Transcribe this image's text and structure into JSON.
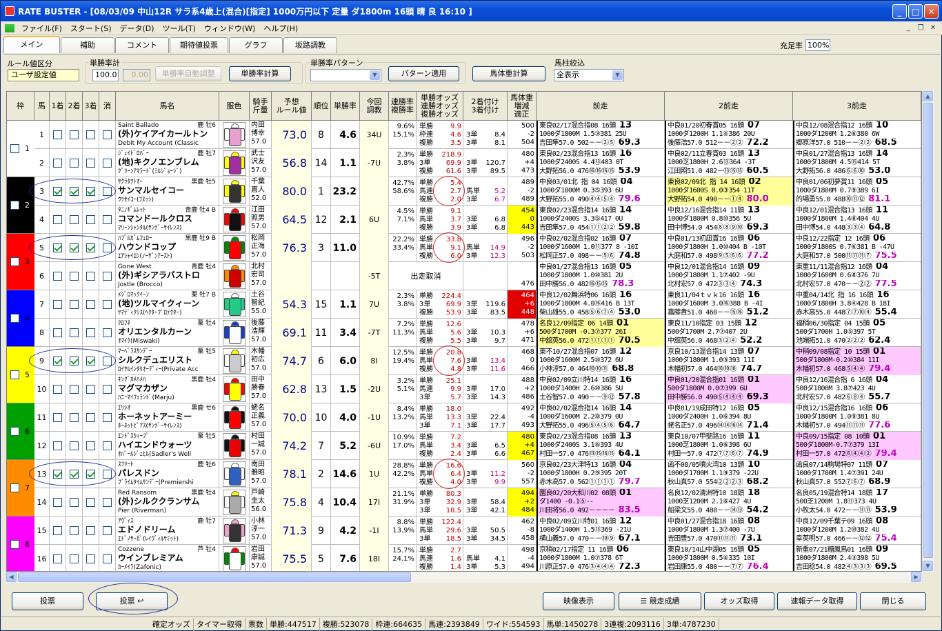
{
  "window": {
    "title": "RATE BUSTER - [08/03/09 中山12R サラ系4歳上(混合)[指定] 1000万円以下 定量 ダ1800m 16頭 晴 良 16:10 ]"
  },
  "menu": [
    "ファイル(F)",
    "スタート(S)",
    "データ(D)",
    "ツール(T)",
    "ウィンドウ(W)",
    "ヘルプ(H)"
  ],
  "tabs": [
    "メイン",
    "補助",
    "コメント",
    "期待値投票",
    "グラフ",
    "坂路調教"
  ],
  "fill_rate": {
    "label": "充足率",
    "value": "100%"
  },
  "controls": {
    "rule_group": "ルール値区分",
    "rule_value": "ユーザ設定値",
    "win_group": "単勝率計",
    "win_input": "100.0",
    "win_input2": "0.00",
    "auto_btn": "単勝率自動調整",
    "calc_btn": "単勝率計算",
    "pattern_group": "単勝率パターン",
    "pattern_btn": "パターン適用",
    "weight_btn": "馬体重計算",
    "filter_group": "馬柱絞込",
    "filter_value": "全表示"
  },
  "headers": {
    "waku": "枠",
    "uma": "馬",
    "c1": "1着",
    "c2": "2着",
    "c3": "3着",
    "del": "消",
    "name": "馬名",
    "color": "服色",
    "jockey": "騎手\n斤量",
    "pred": "予想\nルール値",
    "rank": "順位",
    "wr": "単勝率",
    "chokyo": "今回\n調教",
    "rate": "連勝率\n複勝率",
    "odds": "単勝オッズ\n連勝オッズ\n複勝オッズ",
    "odds2": "2着付け\n3着付け",
    "bw": "馬体重\n増減\n適正",
    "p1": "前走",
    "p2": "2前走",
    "p3": "3前走"
  },
  "horses": [
    {
      "no": "1",
      "waku": "1",
      "c": [
        0,
        0,
        0,
        0
      ],
      "sire": "Saint Ballado",
      "sx": "鹿 牡6",
      "name": "(外)ケイアイカールトン",
      "dam": "Debit My Account (Classic",
      "jk": "内田\n博幸\n57.0",
      "pv": "73.0",
      "rk": "8",
      "wr": "4.6",
      "ch": "34U",
      "rt": "9.6%\n15.1%",
      "ok": "単勝\n枠連\n複勝",
      "ov": "9.9\n4.6\n3.5",
      "o2k": "3単\n3単",
      "o2v": "8.4\n8.1",
      "bw": "500\n-2\n504",
      "p1": "東良02/17混合指08 16頭 13\n1000ダ1800M 1.5③381 25U\n吉田隼57.0 502－－②⑤ 69.3",
      "p2": "中良01/20初春賞05 16頭 07\n1000ダ1200H 1.1④386 20U\n後藤浩57.0 512－－②② 72.2",
      "p3": "中良12/08混合指12 16頭 10\n1000ダ1200M 1.2⑥380 6W\n郷原洋57.0 510－－②② 68.5",
      "silk": [
        "#fff",
        "#e8a0d0",
        "#fff"
      ]
    },
    {
      "no": "2",
      "waku": "1",
      "c": [
        0,
        0,
        0,
        0
      ],
      "sire": "ｼﾞｪｲﾄﾞﾛﾊﾞｰ",
      "sx": "鹿 牡7",
      "name": "(地)キクノエンブレム",
      "dam": "ｸﾞﾘｰﾝｱﾏﾗｰﾄﾞ(ﾐﾙｼﾞｮｰｼﾞ)",
      "jk": "武士\n沢友\n57.0",
      "pv": "56.8",
      "rk": "14",
      "wr": "1.1",
      "ch": "-7U",
      "rt": "2.3%\n3.8%",
      "ok": "単勝\n3単\n複勝",
      "ov": "218.9\n69.9\n61.6",
      "o2k": "3単\n3単",
      "o2v": "120.7\n89.5",
      "bw": "480\n+4\n473",
      "p1": "東良02/23混合指13 16頭 16\n1000ダ2400S 4.4⑬403 0T\n大野拓56.0 476⑯⑯⑯⑮ 53.9",
      "p2": "中良02/11立春賞03 16頭 13\n1000芝1800H 2.6⑬364 -3T\n江田照51.0 482－⑬⑮⑮ 60.5",
      "p3": "中良01/27混合指13 16頭 14\n1000ダ1800M 4.5⑮414 5T\n大野拓56.0 486⑥⑥⑩ 53.0",
      "silk": [
        "#ff0",
        "#a030a0",
        "#ff0"
      ]
    },
    {
      "no": "3",
      "waku": "2",
      "c": [
        1,
        1,
        1,
        0
      ],
      "sire": "ｻｸﾗﾀｸﾄｵｰ",
      "sx": "黒鹿 牡5",
      "name": "サンマルセイコー",
      "dam": "ｳﾂｾｲｺｰ(ﾌﾇｯｼ)",
      "jk": "千葉\n直人\n52.0",
      "pv": "80.0",
      "rk": "1",
      "wr": "23.2",
      "ch": "",
      "rt": "42.7%\n58.6%",
      "ok": "単勝\n馬連\n複勝",
      "ov": "5.4\n2.7\n2.0",
      "o2k": "馬単\n3単",
      "o2v": "5.2\n6.7",
      "bw": "489\n-2\n489",
      "p1": "中良03/01北 指 04 16頭 04\n1000ダ1800M 0.3⑤393 6U\n大野拓55.0 490④④⑤④ 79.6",
      "p2": "東良02/09北 指 14 16頭 02\n1000ダ1600S 0.0③354 11T\n大野拓54.0 490－－①④ 80.0",
      "p3": "中良01/06初夢賞11 16頭 05\n1000ダ1800M 0.7⑨389 6I\n的場勇55.0 488⑩⑪⑫ 81.1",
      "silk": [
        "#ff0",
        "#333",
        "#ff0"
      ],
      "hl": "p2y"
    },
    {
      "no": "4",
      "waku": "2",
      "c": [
        0,
        0,
        0,
        0
      ],
      "sire": "ﾀﾆﾉｷﾞﾑﾚｯﾄ",
      "sx": "青鹿 牡4 B",
      "name": "コマンドールクロス",
      "dam": "ﾏﾘｰﾝｼｬﾝﾀﾙ(ｻﾝﾃﾞｰｻｲﾚﾝｽ)",
      "jk": "江田\n照男\n57.0",
      "pv": "64.5",
      "rk": "12",
      "wr": "2.1",
      "ch": "6U",
      "rt": "4.5%\n7.1%",
      "ok": "単勝\n馬単\n複勝",
      "ov": "9.1\n3.7\n3.9",
      "o2k": "3単\n3単",
      "o2v": "6.8\n6.8",
      "bw": "454\n0\n443",
      "p1": "東良02/23混合指14 16頭 14\n1000ダ2400S 3.3⑤417 0U\n吉田隼57.0 454①①②② 59.8",
      "p2": "中良12/16混合指14 11頭 13\n1000ダ1800M 0.8⑩356 5U\n田中博54.0 454⑧⑧⑨⑩ 69.3",
      "p3": "中良12/01混合指13 16頭 11\n1000ダ1800M 1.4⑧404 4U\n田中博54.0 448③③④ 64.8",
      "silk": [
        "#f00",
        "#111",
        "#f00"
      ],
      "bwhl": "yel"
    },
    {
      "no": "5",
      "waku": "3",
      "c": [
        1,
        1,
        1,
        0
      ],
      "sire": "ﾊﾌﾞﾙｶﾞﾑﾌｪﾛｰ",
      "sx": "黒鹿 牡9 B",
      "name": "ハウンドコップ",
      "dam": "ｴｱｼｬｲﾛﾝ(ﾉｰｻﾞﾝﾃｰｽﾄ)",
      "jk": "松岡\n正海\n57.0",
      "pv": "76.3",
      "rk": "3",
      "wr": "11.0",
      "ch": "",
      "rt": "22.2%\n33.4%",
      "ok": "単勝\n馬単\n複勝",
      "ov": "33.8\n9.1\n6.0",
      "o2k": "馬単\n3単",
      "o2v": "14.9\n12.3",
      "bw": "496\n-2\n503",
      "p1": "中良02/02混合指02 16頭 07\n1000ダ1600M 1.0⑪377 8 -10I\n松岡正57.0 498－－⑤⑥ 74.8",
      "p2": "中良01/13初凪賞16 16頭 06\n1000ダ1800H 1.0⑩404 B -10T\n大庭和57.0 498⑨⑤⑥⑥ 77.2",
      "p3": "中良12/22指定 12 16頭 06\n1000ダ1800S 0.7⑥381 B -47U\n大庭和57.0 500⑪⑪⑪⑦ 75.5",
      "silk": [
        "#080",
        "#f00",
        "#080"
      ]
    },
    {
      "no": "6",
      "waku": "3",
      "c": [
        0,
        0,
        0,
        0
      ],
      "sire": "Gone West",
      "sx": "青鹿 牡4",
      "name": "(外)ギシアラバストロ",
      "dam": "Jostle (Brocco)",
      "jk": "北村\n宏司\n57.0",
      "pv": "",
      "rk": "",
      "wr": "",
      "ch": "-5T",
      "rt": "",
      "scratch": "出走取消",
      "ok": "",
      "ov": "",
      "o2k": "",
      "o2v": "",
      "bw": "\n\n476",
      "p1": "中良01/27混合指13 16頭 05\n1000ダ1800M 1.0⑩381 2U\n田中勝56.0 482⑯⑮⑮ 78.3",
      "p2": "中良12/01混合指14 16頭 09\n1000ダ1800M 1.1⑦402 -9U\n北村宏57.0 472③③④ 74.3",
      "p3": "東重11/11混合指12 16頭 04\n1000ダ1600M 0.6⑧376 7U\n北村宏57.0 470－－②② 77.5",
      "silk": [
        "#f80",
        "#c00",
        "#f80"
      ]
    },
    {
      "no": "7",
      "waku": "4",
      "c": [
        0,
        0,
        0,
        0
      ],
      "sire": "ﾒｼﾞﾛﾏｯｸｲｰﾝ",
      "sx": "栗 牡7 B",
      "name": "(地)ツルマイクィーン",
      "dam": "ﾔﾏﾃﾞｨｸｼｽ(ﾍｸﾀｰﾌﾟﾛﾃｸﾀｰ)",
      "jk": "土谷\n智紀\n55.0",
      "pv": "54.3",
      "rk": "15",
      "wr": "1.1",
      "ch": "7U",
      "rt": "2.3%\n3.8%",
      "ok": "単勝\n3単\n複勝",
      "ov": "224.4\n69.9\n53.9",
      "o2k": "3単\n3単",
      "o2v": "119.6\n83.5",
      "bw": "464\n+6\n448",
      "p1": "中良12/02舞浜特06 16頭 16\n1000ダ1800M 4.0⑯416 B 13T\n柴山雄55.0 458⑤⑥⑦④ 53.0",
      "p2": "東良11/04ｔｖｋ16 16頭 16\n1000ダ1600M 3.0⑯388 B -4I\n嘉藤貴51.0 460－－⑮⑯ 51.2",
      "p3": "中重04/14北 指 16 16頭 16\n1000ダ1800H 3.8④428 B 18I\n赤木高55.0 448⑦⑦⑩④ 55.4",
      "silk": [
        "#fff",
        "#2c8",
        "#2c8"
      ],
      "bwhl": "red"
    },
    {
      "no": "8",
      "waku": "4",
      "c": [
        0,
        0,
        0,
        0
      ],
      "sire": "ｸﾛﾌﾈ",
      "sx": "栗 牡4",
      "name": "オリエンタルカーン",
      "dam": "ｵﾏｲｸ(Miswaki)",
      "jk": "後藤\n浩輝\n57.0",
      "pv": "69.1",
      "rk": "11",
      "wr": "3.4",
      "ch": "-7T",
      "rt": "7.2%\n11.3%",
      "ok": "単勝\n馬単\n複勝",
      "ov": "12.6\n5.6\n5.5",
      "o2k": "3単\n3単",
      "o2v": "10.3\n9.7",
      "bw": "478\n+6\n471",
      "p1": "名良12/09指定 06 14頭 01\n500ダ1700M -0.3⑦377 26I\n中舘英56.0 472①①①① 70.5",
      "p2": "東良11/10指定 03 15頭 12\n500ダ1700M 2.7⑦407 2U\n中舘英56.0 468③②④ 52.2",
      "p3": "福稍06/30指定 04 15頭 05\n500ダ1700H 1.0⑤397 5T\n池端拓51.0 470②②② 62.4",
      "silk": [
        "#1a3ec8",
        "#fff",
        "#1a3ec8"
      ],
      "hl": "p1y"
    },
    {
      "no": "9",
      "waku": "5",
      "c": [
        1,
        1,
        1,
        0
      ],
      "sire": "ﾏｰﾍﾞﾗｽｻﾝﾃﾞｰ",
      "sx": "栗 牡5",
      "name": "シルクデュエリスト",
      "dam": "ﾛｲﾔﾙｲﾝﾀﾘｵｰﾃﾞｨｰ(Private Acc",
      "jk": "木幡\n初広\n57.0",
      "pv": "74.7",
      "rk": "6",
      "wr": "6.0",
      "ch": "8I",
      "rt": "12.5%\n19.4%",
      "ok": "単勝\n馬単\n複勝",
      "ov": "20.8\n7.6\n4.8",
      "o2k": "3単\n3単",
      "o2v": "13.4\n11.6",
      "bw": "468\n0\n466",
      "p1": "東不10/27混合指07 16頭 12\n1000ダ1600M 2.5⑩372 6U\n小林淳57.0 464⑩⑩⑪ 68.8",
      "p2": "京良10/13混合指14 13頭 07\n1000ダ1800M 1.0⑤393 11I\n木幡初57.0 464⑩⑩⑩ 74.7",
      "p3": "中稍09/08指定 10 15頭 01\n500ダ1800M-0.2⑩384 11I\n木幡初57.0 468⑤④④ 79.4",
      "silk": [
        "#ff0",
        "#ccc",
        "#fff"
      ],
      "hl": "p3pink"
    },
    {
      "no": "10",
      "waku": "5",
      "c": [
        0,
        0,
        0,
        0
      ],
      "sire": "ｷﾝｸﾞｶﾒﾊﾒﾊ",
      "sx": "黒鹿 牡4",
      "name": "マグマカザン",
      "dam": "ﾊﾆｰﾏｲﾌｪﾗﾝﾄﾞ(Marju)",
      "jk": "田中\n勝春\n57.0",
      "pv": "62.8",
      "rk": "13",
      "wr": "1.5",
      "ch": "-2U",
      "rt": "3.2%\n5.1%",
      "ok": "単勝\n馬連\n3単",
      "ov": "25.1\n9.9\n5.7",
      "o2k": "3単\n3単",
      "o2v": "17.0\n14.3",
      "bw": "488\n+2\n486",
      "p1": "中良02/09立川特14 16頭 16\n1000ダ1400H 2.6⑩386 5U\n土谷智57.0 490－－⑨⑫ 57.8",
      "p2": "中良01/20混合指01 16頭 01\n500ダ1800M 0.0⑦399 6U\n田中勝56.0 490⑤④④④ 69.3",
      "p3": "中良12/16混合指 6 16頭 04\n500ダ1800M 3.8⑦423 4U\n北村宏57.0 482⑥⑧④ 55.7",
      "silk": [
        "#f00",
        "#ff0",
        "#f00"
      ],
      "hl": "p2pink"
    },
    {
      "no": "11",
      "waku": "6",
      "c": [
        0,
        0,
        0,
        0
      ],
      "sire": "ｴﾘｼｵ",
      "sx": "黒鹿 セ6",
      "name": "ホーネットアーミー",
      "dam": "ﾎｰﾈｯﾄﾋﾟｱｽ(ｻﾝﾃﾞｰｻｲﾚﾝｽ)",
      "jk": "蛯名\n正義\n57.0",
      "pv": "70.0",
      "rk": "10",
      "wr": "4.0",
      "ch": "-1U",
      "rt": "8.4%\n13.2%",
      "ok": "単勝\n馬単\n3単",
      "ov": "18.0\n13.3\n7.1",
      "o2k": "3単\n3単",
      "o2v": "22.4\n17.7",
      "bw": "492\n-4\n493",
      "p1": "中良02/02混合指14 16頭 14\n1000ダ1600M 2.2⑧379 0U\n大野拓55.0 496⑤④⑤⑥ 64.7",
      "p2": "中良01/19成田特12 16頭 05\n1000ダ2400H 1.0⑥394 8U\n蛯名正57.0 496⑭⑭⑯⑭ 71.4",
      "p3": "中良12/15混合指16 16頭 06\n1000ダ1800M 1.0⑨381 8U\n木幡初57.0 494⑪⑪⑪ 77.6",
      "silk": [
        "#111",
        "#f00",
        "#111"
      ]
    },
    {
      "no": "12",
      "waku": "6",
      "c": [
        0,
        0,
        0,
        0
      ],
      "sire": "ｴﾝﾄﾞｽｳｨｰﾌﾟ",
      "sx": "栗 牡5",
      "name": "ハイエンドウォーツ",
      "dam": "ｵﾊﾞｰﾙｼﾞｪﾋﾙ(Sadler's Well",
      "jk": "村田\n一誠\n57.0",
      "pv": "74.2",
      "rk": "7",
      "wr": "5.2",
      "ch": "-6U",
      "rt": "10.9%\n17.0%",
      "ok": "単勝\n馬単\n複勝",
      "ov": "7.2\n3.4\n2.4",
      "o2k": "3単\n3単",
      "o2v": "6.5\n6.6",
      "bw": "480\n+4\n467",
      "p1": "東良02/23混合指08 16頭 13\n1000ダ2400S 3.1⑥393 4U\n村田一57.0 476⑬⑮⑯⑮ 64.1",
      "p2": "東良10/07甲斐路16 16頭 11\n1000芝1800M 1.0⑥398 6U\n村田一57.0 472⑦⑦⑥⑦ 74.9",
      "p3": "中良09/15指定 08 10頭 01\n500ダ1800M-0.7⑦379 13I\n村田一57.0 472⑥④④② 79.4",
      "silk": [
        "#111",
        "#e00",
        "#111"
      ],
      "bwhl": "yel",
      "hl": "p3pink"
    },
    {
      "no": "13",
      "waku": "7",
      "c": [
        1,
        1,
        1,
        0
      ],
      "sire": "ｽﾌﾘｰﾄ",
      "sx": "鹿 牡6",
      "name": "パレスドン",
      "dam": "ﾌﾟﾗｲﾑﾀｲﾑｻﾝﾃﾞｰ(Premiershi",
      "jk": "南田\n雅昭\n57.0",
      "pv": "78.1",
      "rk": "2",
      "wr": "14.6",
      "ch": "1U",
      "rt": "28.8%\n42.2%",
      "ok": "単勝\n馬単\n複勝",
      "ov": "16.6\n6.4\n4.0",
      "o2k": "3単\n3単",
      "o2v": "11.2\n9.9",
      "bw": "560\n-2\n557",
      "p1": "京良02/23大津特13 16頭 04\n1000ダ1800H 0.2⑨395 20T\n赤木高57.0 562①①①① 79.7",
      "p2": "函不08/05噴火湾10 13頭 10\n1000ダ1700M 1.1⑨379 -22U\n秋山真57.0 554②②②③ 68.2",
      "p3": "函良07/14駒場特07 11頭 07\n1000ダ1700M 1.4⑦391 24U\n秋山真57.0 552⑦⑥⑦ 68.9",
      "silk": [
        "#fff",
        "#3060c0",
        "#fff"
      ]
    },
    {
      "no": "14",
      "waku": "7",
      "c": [
        0,
        0,
        0,
        0
      ],
      "sire": "Red Ransom",
      "sx": "黒鹿 牡4",
      "name": "(外)シルククランサム",
      "dam": "Pier (Riverman)",
      "jk": "戸崎\n圭太\n56.0",
      "pv": "75.8",
      "rk": "4",
      "wr": "10.4",
      "ch": "17I",
      "rt": "21.1%\n31.9%",
      "ok": "単勝\n3単\n3単",
      "ov": "80.3\n32.9\n18.5",
      "o2k": "3単\n3単",
      "o2v": "58.4\n42.1",
      "bw": "494\n+2\n484",
      "p1": "園良02/20大和川02 08頭 01\nダ1400 -0.1⑤--\n川田将56.0 492－－－－ 83.5",
      "p2": "名良12/02清洲特10 18頭 18\n1000芝1200M 2.1⑥427 4U\n船梁文55.0 480－－⑭⑬ 54.2",
      "p3": "名良05/19混合特14 18頭 17\n500芝1200M 1.8⑪373 4U\n小牧太54.0 472－－⑪⑪ 53.9",
      "silk": [
        "#ff0",
        "#aaa",
        "#fff"
      ],
      "bwhl": "yel",
      "hl": "p1pink"
    },
    {
      "no": "15",
      "waku": "8",
      "c": [
        0,
        0,
        0,
        0
      ],
      "sire": "ｱｳﾞｨｽ",
      "sx": "鹿 牡7",
      "name": "エドノドリーム",
      "dam": "ｴﾄﾞﾉｻｰｶﾞ(ﾚｲｳﾞｨﾙｻﾐｯﾄ)",
      "jk": "小林\n淳一\n57.0",
      "pv": "71.3",
      "rk": "9",
      "wr": "4.2",
      "ch": "-1I",
      "rt": "8.8%\n13.9%",
      "ok": "単勝\n馬単\n3単",
      "ov": "122.4\n29.6\n18.5",
      "o2k": "3単\n3単",
      "o2v": "50.5\n34.5",
      "bw": "462\n-8\n458",
      "p1": "中良02/09立川特01 16頭 12\n1000ダ1400H 1.5⑬369 -21U\n横山義57.0 470－－⑩⑨ 67.1",
      "p2": "中良01/27混合指18 16頭 08\n1000ダ1800M 1.3⑦400 -7U\n吉田豊57.0 470⑪⑪⑪ 73.1",
      "p3": "中良12/09千葉テ09 16頭 08\n1000ダ1200M 1.2⑩382 4U\n幸英明57.0 466－－⑫⑫ 75.4",
      "silk": [
        "#f0a0d0",
        "#333",
        "#f0a0d0"
      ]
    },
    {
      "no": "16",
      "waku": "8",
      "c": [
        0,
        0,
        0,
        0
      ],
      "sire": "Cozzene",
      "sx": "芦 牡4",
      "name": "ウインブレミアム",
      "dam": "ｶｰﾒｲﾗ(Zafonic)",
      "jk": "岩田\n康誠\n57.0",
      "pv": "75.5",
      "rk": "5",
      "wr": "7.6",
      "ch": "18I",
      "rt": "15.7%\n24.1%",
      "ok": "単勝\n馬連\n複勝",
      "ov": "2.7\n1.6\n1.4",
      "o2k": "馬単\n3単",
      "o2v": "4.1\n5.3",
      "bw": "498\n-4\n494",
      "p1": "京稍02/17指定 11 16頭 06\n1000ダ1800M 1.0⑦378 6T\n川原正57.0 476③④④④ 72.3",
      "p2": "東良10/14山中湖05 16頭 05\n1000ダ1800M 0.5④335 10I\n岩田康55.0 480－－⑦⑦ 76.4",
      "p3": "新重07/21糖鳳鳥01 16頭 09\n1000ダ1800M 2.4③398 5U\n吉田稔54.0 482④③③③ 69.5",
      "silk": [
        "#e00",
        "#fff",
        "#080"
      ]
    }
  ],
  "bottom": {
    "vote1": "投票",
    "vote2": "投票",
    "video": "映像表示",
    "results": "競走成績",
    "odds": "オッズ取得",
    "flash": "速報データ取得",
    "close": "閉じる"
  },
  "status": [
    "確定オッズ",
    "タイマー取得",
    "票数",
    "単勝:447517",
    "複勝:523078",
    "枠連:664635",
    "馬連:2393849",
    "ワイド:554593",
    "馬単:1450278",
    "3連複:2093116",
    "3単:4787230"
  ],
  "colors": {
    "waku": [
      "#ffffff",
      "#000000",
      "#ff0000",
      "#0000ff",
      "#ffff00",
      "#00a000",
      "#ff8c00",
      "#ff00ff"
    ],
    "accent": "#0a4fd8"
  }
}
